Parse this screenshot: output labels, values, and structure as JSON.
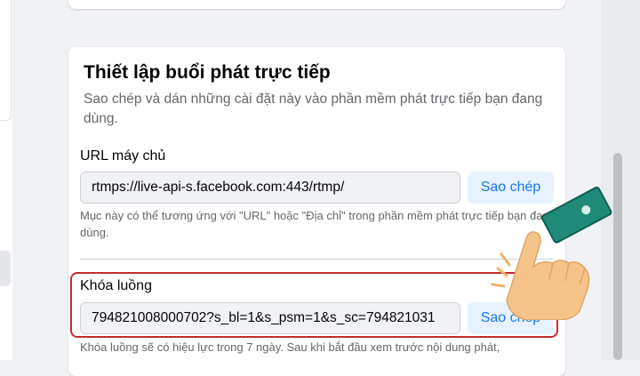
{
  "section": {
    "title": "Thiết lập buổi phát trực tiếp",
    "subtitle": "Sao chép và dán những cài đặt này vào phần mềm phát trực tiếp bạn đang dùng."
  },
  "server_url": {
    "label": "URL máy chủ",
    "value": "rtmps://live-api-s.facebook.com:443/rtmp/",
    "copy_label": "Sao chép",
    "hint": "Mục này có thể tương ứng với \"URL\" hoặc \"Địa chỉ\" trong phần mềm phát trực tiếp bạn đang dùng."
  },
  "stream_key": {
    "label": "Khóa luồng",
    "value": "794821008000702?s_bl=1&s_psm=1&s_sc=794821031",
    "copy_label": "Sao chép",
    "hint": "Khóa luồng sẽ có hiệu lực trong 7 ngày. Sau khi bắt đầu xem trước nội dung phát,"
  },
  "colors": {
    "accent": "#1877f2",
    "highlight": "#c62a2f"
  },
  "icons": {
    "pointer": "pointing-hand-icon"
  }
}
